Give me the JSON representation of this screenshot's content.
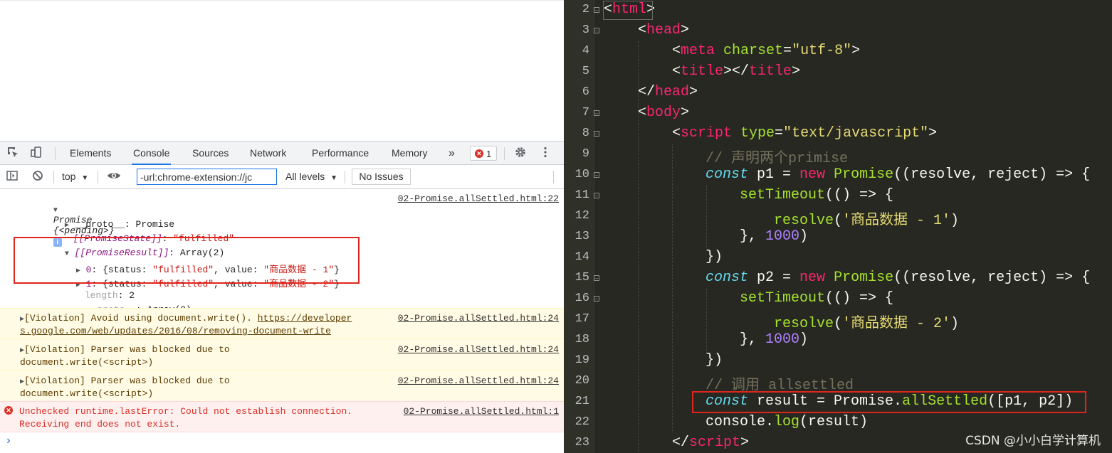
{
  "devtools": {
    "tabs": [
      "Elements",
      "Console",
      "Sources",
      "Network",
      "Performance",
      "Memory"
    ],
    "more_tabs": "»",
    "error_count": "1",
    "toolbar": {
      "context": "top",
      "filter_value": "-url:chrome-extension://jc",
      "levels": "All levels",
      "issues": "No Issues"
    }
  },
  "console": {
    "promise": {
      "header_label": "Promise",
      "header_state": "{<pending>}",
      "source": "02-Promise.allSettled.html:22",
      "proto_key": "__proto__",
      "proto_val": ": Promise",
      "state_key": "[[PromiseState]]",
      "state_val": "\"fulfilled\"",
      "result_key": "[[PromiseResult]]",
      "result_val": ": Array(2)",
      "item0_idx": "0",
      "item0_pre": ": {status: ",
      "item0_status": "\"fulfilled\"",
      "item0_mid": ", value: ",
      "item0_value": "\"商品数据 - 1\"",
      "item0_end": "}",
      "item1_idx": "1",
      "item1_pre": ": {status: ",
      "item1_status": "\"fulfilled\"",
      "item1_mid": ", value: ",
      "item1_value": "\"商品数据 - 2\"",
      "item1_end": "}",
      "length_key": "length",
      "length_val": ": 2",
      "proto2_key": "__proto__",
      "proto2_val": ": Array(0)"
    },
    "violation1": {
      "text1": "[Violation] Avoid using document.write(). ",
      "link1": "https://developer",
      "text2": "s.google.com/web/updates/2016/08/removing-document-write",
      "source": "02-Promise.allSettled.html:24"
    },
    "violation2": {
      "text1": "[Violation] Parser was blocked due to",
      "text2": "document.write(<script>)",
      "source": "02-Promise.allSettled.html:24"
    },
    "violation3": {
      "text1": "[Violation] Parser was blocked due to",
      "text2": "document.write(<script>)",
      "source": "02-Promise.allSettled.html:24"
    },
    "error": {
      "text1": "Unchecked runtime.lastError: Could not establish connection.",
      "text2": "Receiving end does not exist.",
      "source": "02-Promise.allSettled.html:1"
    },
    "prompt": "›"
  },
  "editor": {
    "line_numbers": [
      "2",
      "3",
      "4",
      "5",
      "6",
      "7",
      "8",
      "9",
      "10",
      "11",
      "12",
      "13",
      "14",
      "15",
      "16",
      "17",
      "18",
      "19",
      "20",
      "21",
      "22",
      "23"
    ],
    "lines": {
      "l2_open": "<",
      "l2_tag": "html",
      "l2_close": ">",
      "l3_open": "<",
      "l3_tag": "head",
      "l3_close": ">",
      "l4_open": "<",
      "l4_tag": "meta",
      "l4_attr": " charset",
      "l4_eq": "=",
      "l4_val": "\"utf-8\"",
      "l4_close": ">",
      "l5_open": "<",
      "l5_tag": "title",
      "l5_mid": "></",
      "l5_tag2": "title",
      "l5_close": ">",
      "l6_open": "</",
      "l6_tag": "head",
      "l6_close": ">",
      "l7_open": "<",
      "l7_tag": "body",
      "l7_close": ">",
      "l8_open": "<",
      "l8_tag": "script",
      "l8_attr": " type",
      "l8_eq": "=",
      "l8_val": "\"text/javascript\"",
      "l8_close": ">",
      "l9_comment": "// 声明两个primise",
      "l10_kw": "const",
      "l10_a": " p1 = ",
      "l10_new": "new",
      "l10_sp": " ",
      "l10_cls": "Promise",
      "l10_b": "((resolve, reject) => {",
      "l11_fn": "setTimeout",
      "l11_b": "(() => {",
      "l12_fn": "resolve",
      "l12_a": "(",
      "l12_str": "'商品数据 - 1'",
      "l12_b": ")",
      "l13_a": "}, ",
      "l13_num": "1000",
      "l13_b": ")",
      "l14_a": "})",
      "l15_kw": "const",
      "l15_a": " p2 = ",
      "l15_new": "new",
      "l15_sp": " ",
      "l15_cls": "Promise",
      "l15_b": "((resolve, reject) => {",
      "l16_fn": "setTimeout",
      "l16_b": "(() => {",
      "l17_fn": "resolve",
      "l17_a": "(",
      "l17_str": "'商品数据 - 2'",
      "l17_b": ")",
      "l18_a": "}, ",
      "l18_num": "1000",
      "l18_b": ")",
      "l19_a": "})",
      "l20_comment": "// 调用 allsettled",
      "l21_kw": "const",
      "l21_a": " result = Promise.",
      "l21_fn": "allSettled",
      "l21_b": "([p1, p2])",
      "l22_a": "console.",
      "l22_fn": "log",
      "l22_b": "(result)",
      "l23_open": "</",
      "l23_tag": "script",
      "l23_close": ">"
    }
  },
  "watermark": "CSDN @小小白学计算机",
  "colors": {
    "highlight_box": "#e0261c",
    "editor_bg": "#272822",
    "active_tab": "#1a73e8"
  }
}
